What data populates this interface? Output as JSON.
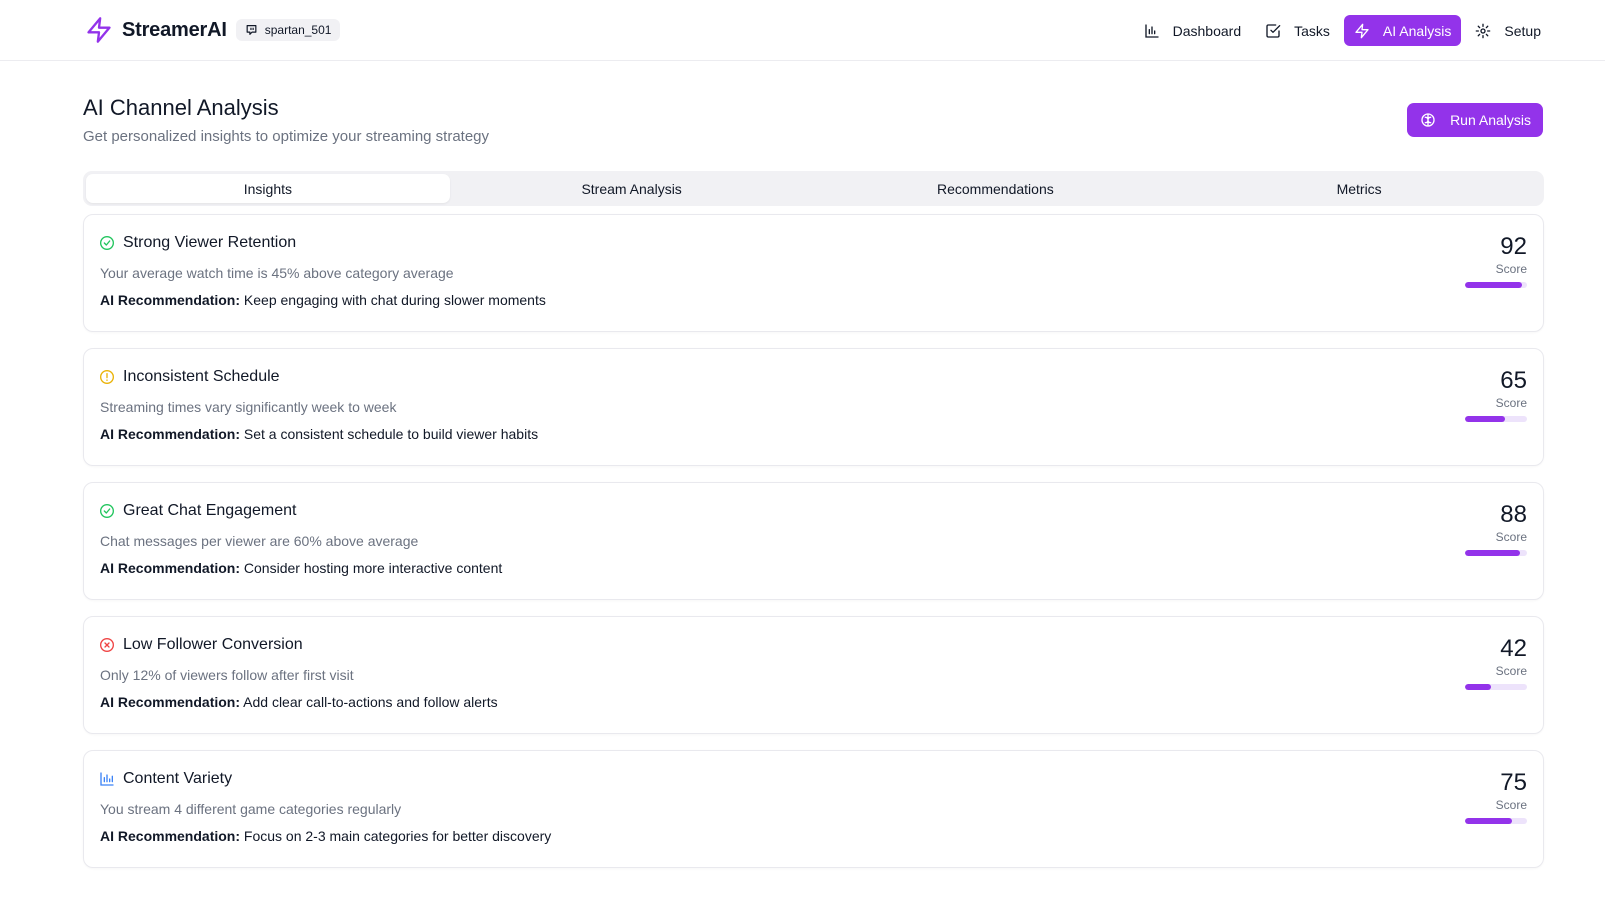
{
  "brand": {
    "name": "StreamerAI",
    "username": "spartan_501"
  },
  "nav": [
    {
      "label": "Dashboard",
      "icon": "bar-chart-icon",
      "active": false
    },
    {
      "label": "Tasks",
      "icon": "check-square-icon",
      "active": false
    },
    {
      "label": "AI Analysis",
      "icon": "lightning-icon",
      "active": true
    },
    {
      "label": "Setup",
      "icon": "gear-icon",
      "active": false
    }
  ],
  "page": {
    "title": "AI Channel Analysis",
    "subtitle": "Get personalized insights to optimize your streaming strategy",
    "run_button": "Run Analysis"
  },
  "tabs": [
    {
      "label": "Insights",
      "active": true
    },
    {
      "label": "Stream Analysis",
      "active": false
    },
    {
      "label": "Recommendations",
      "active": false
    },
    {
      "label": "Metrics",
      "active": false
    }
  ],
  "rec_prefix": "AI Recommendation:",
  "score_label": "Score",
  "insights": [
    {
      "status": "success",
      "icon": "check-circle-icon",
      "color": "#22c55e",
      "title": "Strong Viewer Retention",
      "description": "Your average watch time is 45% above category average",
      "recommendation": "Keep engaging with chat during slower moments",
      "score": 92
    },
    {
      "status": "warning",
      "icon": "alert-circle-icon",
      "color": "#eab308",
      "title": "Inconsistent Schedule",
      "description": "Streaming times vary significantly week to week",
      "recommendation": "Set a consistent schedule to build viewer habits",
      "score": 65
    },
    {
      "status": "success",
      "icon": "check-circle-icon",
      "color": "#22c55e",
      "title": "Great Chat Engagement",
      "description": "Chat messages per viewer are 60% above average",
      "recommendation": "Consider hosting more interactive content",
      "score": 88
    },
    {
      "status": "error",
      "icon": "x-circle-icon",
      "color": "#ef4444",
      "title": "Low Follower Conversion",
      "description": "Only 12% of viewers follow after first visit",
      "recommendation": "Add clear call-to-actions and follow alerts",
      "score": 42
    },
    {
      "status": "info",
      "icon": "bar-chart-icon",
      "color": "#3b82f6",
      "title": "Content Variety",
      "description": "You stream 4 different game categories regularly",
      "recommendation": "Focus on 2-3 main categories for better discovery",
      "score": 75
    }
  ],
  "colors": {
    "accent": "#9333ea",
    "bar_track": "#ede3fb"
  }
}
